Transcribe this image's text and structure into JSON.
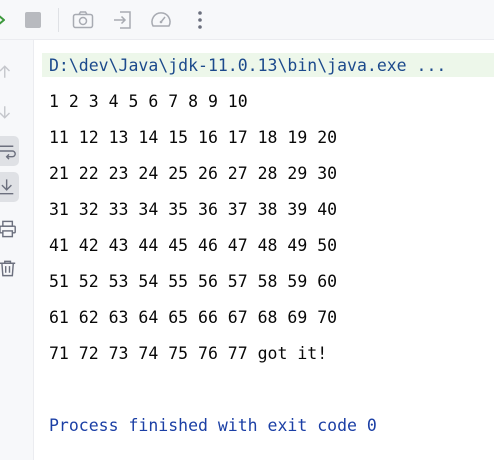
{
  "toolbar": {
    "icons": [
      "rerun-icon",
      "stop-icon",
      "screenshot-icon",
      "exit-icon",
      "profiler-icon",
      "more-vertical-icon"
    ]
  },
  "gutter": {
    "icons": [
      "scroll-up-icon",
      "scroll-down-icon",
      "soft-wrap-icon",
      "scroll-to-end-icon",
      "print-icon",
      "clear-all-icon"
    ],
    "active": [
      "soft-wrap-icon",
      "scroll-to-end-icon"
    ]
  },
  "console": {
    "command": "D:\\dev\\Java\\jdk-11.0.13\\bin\\java.exe ...",
    "output_lines": [
      "1 2 3 4 5 6 7 8 9 10",
      "11 12 13 14 15 16 17 18 19 20",
      "21 22 23 24 25 26 27 28 29 30",
      "31 32 33 34 35 36 37 38 39 40",
      "41 42 43 44 45 46 47 48 49 50",
      "51 52 53 54 55 56 57 58 59 60",
      "61 62 63 64 65 66 67 68 69 70",
      "71 72 73 74 75 76 77 got it!"
    ],
    "finished_message": "Process finished with exit code 0"
  },
  "colors": {
    "command_background": "#edf7ea",
    "command_text": "#1c4a8c",
    "finished_text": "#1b3fa5",
    "output_text": "#080808",
    "panel_background": "#f7f8fa"
  }
}
